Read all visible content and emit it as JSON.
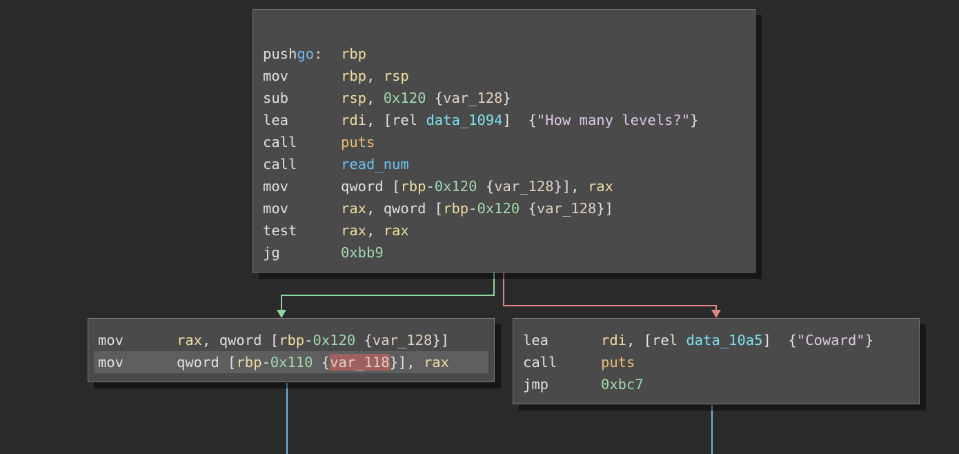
{
  "blocks": {
    "top": {
      "label": "go",
      "label_suffix": ":",
      "lines": [
        {
          "op": "push",
          "tokens": [
            {
              "t": "rbp",
              "c": "reg"
            }
          ]
        },
        {
          "op": "mov",
          "tokens": [
            {
              "t": "rbp",
              "c": "reg"
            },
            {
              "t": ", ",
              "c": "plain"
            },
            {
              "t": "rsp",
              "c": "reg"
            }
          ]
        },
        {
          "op": "sub",
          "tokens": [
            {
              "t": "rsp",
              "c": "reg"
            },
            {
              "t": ", ",
              "c": "plain"
            },
            {
              "t": "0x120",
              "c": "num"
            },
            {
              "t": " {",
              "c": "plain"
            },
            {
              "t": "var_128",
              "c": "var"
            },
            {
              "t": "}",
              "c": "plain"
            }
          ]
        },
        {
          "op": "lea",
          "tokens": [
            {
              "t": "rdi",
              "c": "reg"
            },
            {
              "t": ", [rel ",
              "c": "plain"
            },
            {
              "t": "data_1094",
              "c": "data"
            },
            {
              "t": "]  {",
              "c": "plain"
            },
            {
              "t": "\"How many levels?\"",
              "c": "str"
            },
            {
              "t": "}",
              "c": "plain"
            }
          ]
        },
        {
          "op": "call",
          "tokens": [
            {
              "t": "puts",
              "c": "func"
            }
          ]
        },
        {
          "op": "call",
          "tokens": [
            {
              "t": "read_num",
              "c": "rfunc"
            }
          ]
        },
        {
          "op": "mov",
          "tokens": [
            {
              "t": "qword [",
              "c": "plain"
            },
            {
              "t": "rbp",
              "c": "reg"
            },
            {
              "t": "-",
              "c": "plain"
            },
            {
              "t": "0x120",
              "c": "num"
            },
            {
              "t": " {",
              "c": "plain"
            },
            {
              "t": "var_128",
              "c": "var"
            },
            {
              "t": "}], ",
              "c": "plain"
            },
            {
              "t": "rax",
              "c": "reg"
            }
          ]
        },
        {
          "op": "mov",
          "tokens": [
            {
              "t": "rax",
              "c": "reg"
            },
            {
              "t": ", qword [",
              "c": "plain"
            },
            {
              "t": "rbp",
              "c": "reg"
            },
            {
              "t": "-",
              "c": "plain"
            },
            {
              "t": "0x120",
              "c": "num"
            },
            {
              "t": " {",
              "c": "plain"
            },
            {
              "t": "var_128",
              "c": "var"
            },
            {
              "t": "}]",
              "c": "plain"
            }
          ]
        },
        {
          "op": "test",
          "tokens": [
            {
              "t": "rax",
              "c": "reg"
            },
            {
              "t": ", ",
              "c": "plain"
            },
            {
              "t": "rax",
              "c": "reg"
            }
          ]
        },
        {
          "op": "jg",
          "tokens": [
            {
              "t": "0xbb9",
              "c": "num"
            }
          ]
        }
      ]
    },
    "left": {
      "lines": [
        {
          "op": "mov",
          "tokens": [
            {
              "t": "rax",
              "c": "reg"
            },
            {
              "t": ", qword [",
              "c": "plain"
            },
            {
              "t": "rbp",
              "c": "reg"
            },
            {
              "t": "-",
              "c": "plain"
            },
            {
              "t": "0x120",
              "c": "num"
            },
            {
              "t": " {",
              "c": "plain"
            },
            {
              "t": "var_128",
              "c": "var"
            },
            {
              "t": "}]",
              "c": "plain"
            }
          ]
        },
        {
          "op": "mov",
          "highlight": true,
          "tokens": [
            {
              "t": "qword [",
              "c": "plain"
            },
            {
              "t": "rbp",
              "c": "reg"
            },
            {
              "t": "-",
              "c": "plain"
            },
            {
              "t": "0x110",
              "c": "num"
            },
            {
              "t": " {",
              "c": "plain"
            },
            {
              "t": "var_118",
              "c": "var",
              "hl": true
            },
            {
              "t": "}], ",
              "c": "plain"
            },
            {
              "t": "rax",
              "c": "reg"
            }
          ]
        }
      ]
    },
    "right": {
      "lines": [
        {
          "op": "lea",
          "tokens": [
            {
              "t": "rdi",
              "c": "reg"
            },
            {
              "t": ", [rel ",
              "c": "plain"
            },
            {
              "t": "data_10a5",
              "c": "data"
            },
            {
              "t": "]  {",
              "c": "plain"
            },
            {
              "t": "\"Coward\"",
              "c": "str"
            },
            {
              "t": "}",
              "c": "plain"
            }
          ]
        },
        {
          "op": "call",
          "tokens": [
            {
              "t": "puts",
              "c": "func"
            }
          ]
        },
        {
          "op": "jmp",
          "tokens": [
            {
              "t": "0xbc7",
              "c": "num"
            }
          ]
        }
      ]
    }
  },
  "colors": {
    "true_edge": "#8fd6a0",
    "false_edge": "#e0868a",
    "unconditional_edge": "#6fb8e8"
  }
}
